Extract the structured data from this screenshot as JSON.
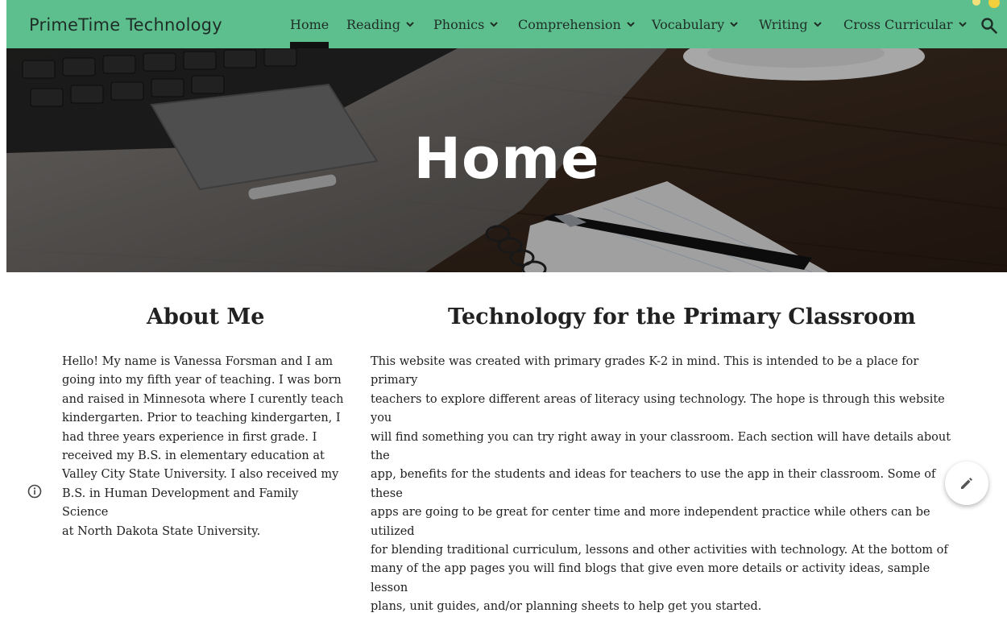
{
  "site": {
    "brand": "PrimeTime Technology"
  },
  "nav": {
    "items": [
      {
        "label": "Home",
        "has_dropdown": false,
        "active": true
      },
      {
        "label": "Reading",
        "has_dropdown": true
      },
      {
        "label": "Phonics",
        "has_dropdown": true
      },
      {
        "label": "Comprehension",
        "has_dropdown": true
      },
      {
        "label": "Vocabulary",
        "has_dropdown": true
      },
      {
        "label": "Writing",
        "has_dropdown": true
      },
      {
        "label": "Cross Curricular",
        "has_dropdown": true
      }
    ],
    "search_icon": "search-icon"
  },
  "hero": {
    "title": "Home"
  },
  "about": {
    "heading": "About Me",
    "lines": [
      "Hello! My name is Vanessa Forsman and I am",
      "going into my fifth year of teaching. I was born",
      "and raised in Minnesota where I curently teach",
      "kindergarten. Prior to teaching kindergarten, I",
      "had three years experience in first grade. I",
      "received my B.S. in elementary education at",
      "Valley City State University. I also received my",
      "B.S. in Human Development and Family Science",
      "at North Dakota State University."
    ]
  },
  "tech": {
    "heading": "Technology for the Primary Classroom",
    "lines": [
      "This website was created with primary grades K-2 in mind. This is intended to be a place for primary",
      "teachers to explore different areas of literacy using technology. The hope is through this website you",
      "will find something you can try right away in your classroom. Each section will have details about the",
      "app, benefits for the students and ideas for teachers to use the app in their classroom. Some of these",
      "apps are going to be great for center time and more independent practice while others can be utilized",
      "for blending traditional curriculum, lessons and other activities with technology. At the bottom of",
      "many of the app pages you will find blogs that give even more details or activity ideas, sample lesson",
      "plans, unit guides, and/or planning sheets to help get you started."
    ]
  },
  "colors": {
    "navbar": "#5dbf8e",
    "active_indicator": "#111111",
    "text": "#212121"
  },
  "icons": {
    "info": "info-icon",
    "edit": "pencil-icon"
  }
}
